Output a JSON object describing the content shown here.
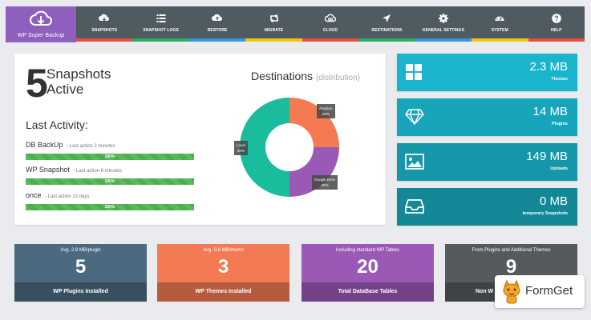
{
  "app": {
    "logo_text": "WP Super Backup"
  },
  "nav": {
    "items": [
      {
        "label": "SNAPSHOTS",
        "icon": "cloud-download-icon"
      },
      {
        "label": "SNAPSHOT LOGS",
        "icon": "list-icon"
      },
      {
        "label": "RESTORE",
        "icon": "cloud-upload-icon"
      },
      {
        "label": "MIGRATE",
        "icon": "retweet-icon"
      },
      {
        "label": "CLOUD",
        "icon": "cloud-icon"
      },
      {
        "label": "DESTINATIONS",
        "icon": "location-arrow-icon"
      },
      {
        "label": "GENERAL SETTINGS",
        "icon": "gear-icon"
      },
      {
        "label": "SYSTEM",
        "icon": "dashboard-icon"
      },
      {
        "label": "HELP",
        "icon": "question-icon"
      }
    ],
    "colors": [
      "#e74c3c",
      "#27ae60",
      "#3498db",
      "#f1c40f",
      "#e74c3c",
      "#27ae60",
      "#3498db",
      "#f1c40f",
      "#e74c3c"
    ]
  },
  "summary": {
    "count": "5",
    "line1": "Snapshots",
    "line2": "Active"
  },
  "last_activity": {
    "title": "Last Activity:",
    "items": [
      {
        "name": "DB BackUp",
        "time": "- Last action 2 minutes",
        "progress": "100%"
      },
      {
        "name": "WP Snapshot",
        "time": "- Last action 8 minutes",
        "progress": "100%"
      },
      {
        "name": "once",
        "time": "- Last action 13 days",
        "progress": "100%"
      }
    ]
  },
  "destinations": {
    "title": "Destinations",
    "subtitle": "(distribution)",
    "slices": [
      {
        "name": "Amazon",
        "percent": "25%",
        "color": "#f47a54"
      },
      {
        "name": "Google Drive",
        "percent": "25%",
        "color": "#9b59b6"
      },
      {
        "name": "Local",
        "percent": "50%",
        "color": "#1abc9c"
      }
    ]
  },
  "stats": [
    {
      "value": "2.3 MB",
      "label": "Themes",
      "icon": "grid-icon",
      "color": "#1ab4cc"
    },
    {
      "value": "14 MB",
      "label": "Plugins",
      "icon": "diamond-icon",
      "color": "#17a5bb"
    },
    {
      "value": "149 MB",
      "label": "Uploads",
      "icon": "image-icon",
      "color": "#1596a9"
    },
    {
      "value": "0 MB",
      "label": "temporary Snapshots",
      "icon": "inbox-icon",
      "color": "#148896"
    }
  ],
  "tiles": [
    {
      "sub": "Avg. 2.8 MB/plugin",
      "num": "5",
      "foot": "WP Plugins Installed",
      "color": "#4b6a80"
    },
    {
      "sub": "Avg. 0.8 MB/theme",
      "num": "3",
      "foot": "WP Themes Installed",
      "color": "#f47a54"
    },
    {
      "sub": "Including standard WP Tables",
      "num": "20",
      "foot": "Total DataBase Tables",
      "color": "#9b59b6"
    },
    {
      "sub": "From Plugins and Additional Themes",
      "num": "9",
      "foot": "Non W",
      "color": "#555a5f"
    }
  ],
  "badge": {
    "text": "FormGet"
  }
}
